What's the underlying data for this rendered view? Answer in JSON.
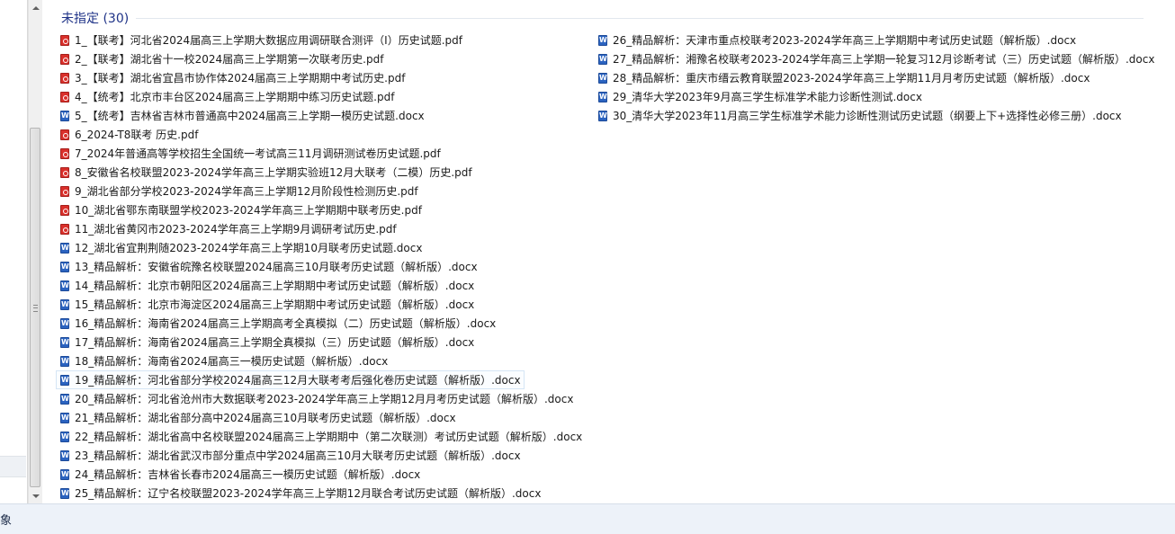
{
  "group": {
    "title": "未指定 (30)"
  },
  "files": {
    "col1": [
      {
        "name": "1_【联考】河北省2024届高三上学期大数据应用调研联合测评（I）历史试题.pdf",
        "type": "pdf"
      },
      {
        "name": "2_【联考】湖北省十一校2024届高三上学期第一次联考历史.pdf",
        "type": "pdf"
      },
      {
        "name": "3_【联考】湖北省宜昌市协作体2024届高三上学期期中考试历史.pdf",
        "type": "pdf"
      },
      {
        "name": "4_【统考】北京市丰台区2024届高三上学期期中练习历史试题.pdf",
        "type": "pdf"
      },
      {
        "name": "5_【统考】吉林省吉林市普通高中2024届高三上学期一模历史试题.docx",
        "type": "docx"
      },
      {
        "name": "6_2024-T8联考 历史.pdf",
        "type": "pdf"
      },
      {
        "name": "7_2024年普通高等学校招生全国统一考试高三11月调研测试卷历史试题.pdf",
        "type": "pdf"
      },
      {
        "name": "8_安徽省名校联盟2023-2024学年高三上学期实验班12月大联考（二模）历史.pdf",
        "type": "pdf"
      },
      {
        "name": "9_湖北省部分学校2023-2024学年高三上学期12月阶段性检测历史.pdf",
        "type": "pdf"
      },
      {
        "name": "10_湖北省鄂东南联盟学校2023-2024学年高三上学期期中联考历史.pdf",
        "type": "pdf"
      },
      {
        "name": "11_湖北省黄冈市2023-2024学年高三上学期9月调研考试历史.pdf",
        "type": "pdf"
      },
      {
        "name": "12_湖北省宜荆荆随2023-2024学年高三上学期10月联考历史试题.docx",
        "type": "docx"
      },
      {
        "name": "13_精品解析：安徽省皖豫名校联盟2024届高三10月联考历史试题（解析版）.docx",
        "type": "docx"
      },
      {
        "name": "14_精品解析：北京市朝阳区2024届高三上学期期中考试历史试题（解析版）.docx",
        "type": "docx"
      },
      {
        "name": "15_精品解析：北京市海淀区2024届高三上学期期中考试历史试题（解析版）.docx",
        "type": "docx"
      },
      {
        "name": "16_精品解析：海南省2024届高三上学期高考全真模拟（二）历史试题（解析版）.docx",
        "type": "docx"
      },
      {
        "name": "17_精品解析：海南省2024届高三上学期全真模拟（三）历史试题（解析版）.docx",
        "type": "docx"
      },
      {
        "name": "18_精品解析：海南省2024届高三一模历史试题（解析版）.docx",
        "type": "docx"
      },
      {
        "name": "19_精品解析：河北省部分学校2024届高三12月大联考考后强化卷历史试题（解析版）.docx",
        "type": "docx",
        "selected": true
      },
      {
        "name": "20_精品解析：河北省沧州市大数据联考2023-2024学年高三上学期12月月考历史试题（解析版）.docx",
        "type": "docx"
      },
      {
        "name": "21_精品解析：湖北省部分高中2024届高三10月联考历史试题（解析版）.docx",
        "type": "docx"
      },
      {
        "name": "22_精品解析：湖北省高中名校联盟2024届高三上学期期中（第二次联测）考试历史试题（解析版）.docx",
        "type": "docx"
      },
      {
        "name": "23_精品解析：湖北省武汉市部分重点中学2024届高三10月大联考历史试题（解析版）.docx",
        "type": "docx"
      },
      {
        "name": "24_精品解析：吉林省长春市2024届高三一模历史试题（解析版）.docx",
        "type": "docx"
      },
      {
        "name": "25_精品解析：辽宁名校联盟2023-2024学年高三上学期12月联合考试历史试题（解析版）.docx",
        "type": "docx"
      }
    ],
    "col2": [
      {
        "name": "26_精品解析：天津市重点校联考2023-2024学年高三上学期期中考试历史试题（解析版）.docx",
        "type": "docx"
      },
      {
        "name": "27_精品解析：湘豫名校联考2023-2024学年高三上学期一轮复习12月诊断考试（三）历史试题（解析版）.docx",
        "type": "docx"
      },
      {
        "name": "28_精品解析：重庆市缙云教育联盟2023-2024学年高三上学期11月月考历史试题（解析版）.docx",
        "type": "docx"
      },
      {
        "name": "29_清华大学2023年9月高三学生标准学术能力诊断性测试.docx",
        "type": "docx"
      },
      {
        "name": "30_清华大学2023年11月高三学生标准学术能力诊断性测试历史试题（纲要上下+选择性必修三册）.docx",
        "type": "docx"
      }
    ]
  },
  "statusbar": {
    "text": "象"
  }
}
